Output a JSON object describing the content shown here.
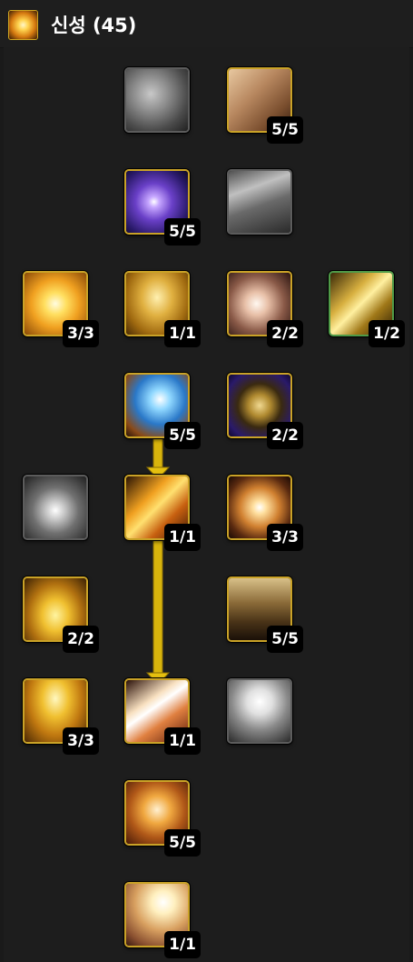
{
  "header": {
    "tree_icon": "holy-burst-icon",
    "title": "신성 (45)"
  },
  "colors": {
    "background": "#1a1a1a",
    "learned_border": "#c9a227",
    "locked_border": "#5c5c5c",
    "alt_border": "#4f9a48",
    "arrow": "#e5c00f"
  },
  "talents": [
    {
      "icon": "stone-skin-icon",
      "state": "locked",
      "rank": ""
    },
    {
      "icon": "scroll-icon",
      "state": "learned",
      "rank": "5/5"
    },
    {
      "icon": "divine-head-icon",
      "state": "learned",
      "rank": "5/5"
    },
    {
      "icon": "hammer-icon",
      "state": "locked",
      "rank": ""
    },
    {
      "icon": "holy-burst-icon",
      "state": "learned",
      "rank": "3/3"
    },
    {
      "icon": "radiant-figure-icon",
      "state": "learned",
      "rank": "1/1"
    },
    {
      "icon": "glowing-hand-icon",
      "state": "learned",
      "rank": "2/2"
    },
    {
      "icon": "golden-wings-icon",
      "state": "learned-alt",
      "rank": "1/2"
    },
    {
      "icon": "blessing-hand-icon",
      "state": "learned",
      "rank": "5/5"
    },
    {
      "icon": "holy-cross-shield-icon",
      "state": "learned",
      "rank": "2/2"
    },
    {
      "icon": "light-explosion-icon",
      "state": "locked",
      "rank": ""
    },
    {
      "icon": "flaming-gauntlet-icon",
      "state": "learned",
      "rank": "1/1"
    },
    {
      "icon": "arcane-orb-icon",
      "state": "learned",
      "rank": "3/3"
    },
    {
      "icon": "golden-fire-icon",
      "state": "learned",
      "rank": "2/2"
    },
    {
      "icon": "armored-paladin-icon",
      "state": "learned",
      "rank": "5/5"
    },
    {
      "icon": "golden-pillar-icon",
      "state": "learned",
      "rank": "3/3"
    },
    {
      "icon": "flaming-sword-icon",
      "state": "learned",
      "rank": "1/1"
    },
    {
      "icon": "radiant-angel-icon",
      "state": "locked",
      "rank": ""
    },
    {
      "icon": "sacred-altar-icon",
      "state": "learned",
      "rank": "5/5"
    },
    {
      "icon": "healing-light-icon",
      "state": "learned",
      "rank": "1/1"
    }
  ]
}
